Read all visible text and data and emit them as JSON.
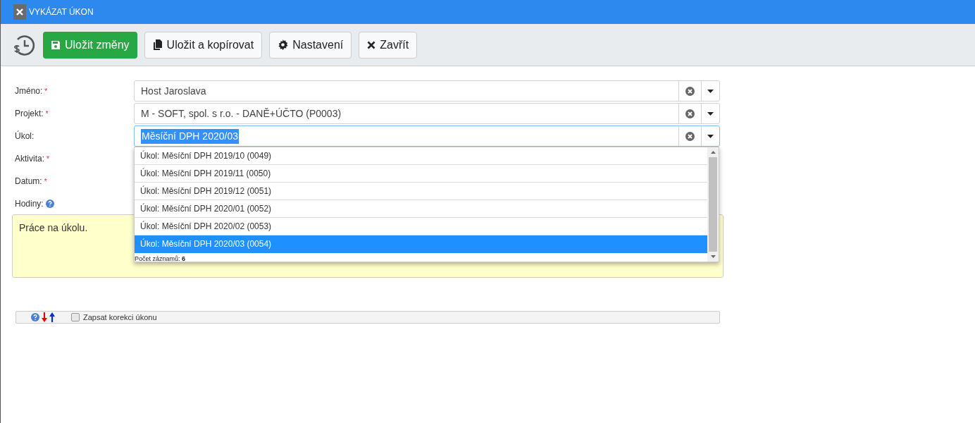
{
  "window": {
    "title": "VYKÁZAT ÚKON"
  },
  "toolbar": {
    "buttons": [
      {
        "kind": "save",
        "label": "Uložit změny"
      },
      {
        "kind": "copy",
        "label": "Uložit a kopírovat"
      },
      {
        "kind": "settings",
        "label": "Nastavení"
      },
      {
        "kind": "close",
        "label": "Zavřít"
      }
    ]
  },
  "form": {
    "fields": [
      {
        "label": "Jméno:",
        "required_mark": "*",
        "value": "Host Jaroslava",
        "focused": false
      },
      {
        "label": "Projekt:",
        "required_mark": "*",
        "value": "M - SOFT, spol. s r.o. - DANĚ+ÚČTO (P0003)",
        "focused": false
      },
      {
        "label": "Úkol:",
        "value": "Měsíční DPH 2020/03",
        "focused": true
      },
      {
        "label": "Aktivita:",
        "required_mark": "*"
      },
      {
        "label": "Datum:",
        "required_mark": "*"
      },
      {
        "label": "Hodiny:",
        "help": true
      }
    ],
    "note": "Práce na úkolu."
  },
  "dropdown": {
    "items": [
      {
        "label": "Úkol: Měsíční DPH 2019/10 (0049)",
        "selected": false
      },
      {
        "label": "Úkol: Měsíční DPH 2019/11 (0050)",
        "selected": false
      },
      {
        "label": "Úkol: Měsíční DPH 2019/12 (0051)",
        "selected": false
      },
      {
        "label": "Úkol: Měsíční DPH 2020/01 (0052)",
        "selected": false
      },
      {
        "label": "Úkol: Měsíční DPH 2020/02 (0053)",
        "selected": false
      },
      {
        "label": "Úkol: Měsíční DPH 2020/03 (0054)",
        "selected": true
      }
    ],
    "footer": "Počet záznamů: **6**"
  },
  "bottom_bar": {
    "checkbox": {
      "label": "Zapsat korekci úkonu",
      "checked": false
    }
  }
}
